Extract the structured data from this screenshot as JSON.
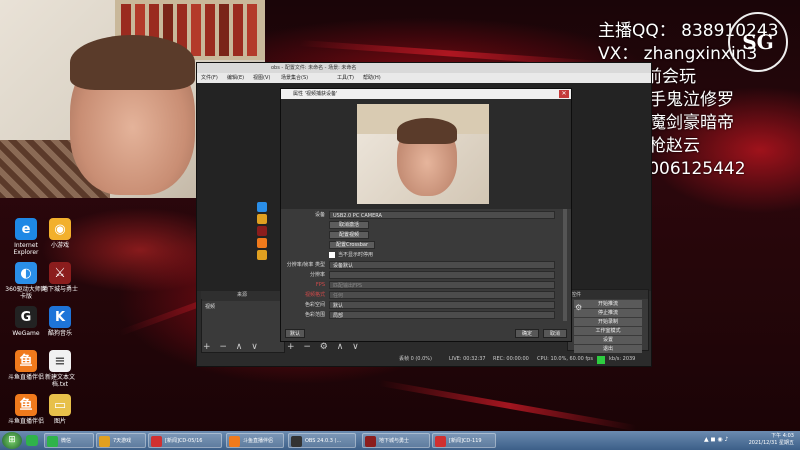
{
  "overlay": {
    "qq": "主播QQ：  838910243",
    "vx": "VX：  zhangxinxin3",
    "current_label": "目前会玩",
    "classes_line1": "红眼白手鬼泣修罗",
    "classes_line2": "剑宗剑魔剑豪暗帝",
    "classes_line3": "光枪赵云",
    "group": "群：  1006125442",
    "logo": "SG"
  },
  "desktop_icons": [
    {
      "label": "Internet Explorer",
      "icon": "ie-icon",
      "color": "#1e88e5",
      "glyph": "e"
    },
    {
      "label": "小游戏",
      "icon": "game-icon",
      "color": "#f2b02c",
      "glyph": "◉"
    },
    {
      "label": "360驱动大师网卡版",
      "icon": "driver-icon",
      "color": "#2a8ee8",
      "glyph": "◐"
    },
    {
      "label": "地下城与勇士",
      "icon": "dnf-icon",
      "color": "#8b1d1d",
      "glyph": "⚔"
    },
    {
      "label": "WeGame",
      "icon": "wegame-icon",
      "color": "#222222",
      "glyph": "G"
    },
    {
      "label": "酷狗音乐",
      "icon": "kugou-icon",
      "color": "#1e74d8",
      "glyph": "K"
    },
    {
      "label": "斗鱼直播伴侣",
      "icon": "douyu-icon",
      "color": "#f07a1c",
      "glyph": "鱼"
    },
    {
      "label": "新建文本文档.txt",
      "icon": "textfile-icon",
      "color": "#f1f1f1",
      "glyph": "≡"
    },
    {
      "label": "斗鱼直播伴侣",
      "icon": "douyu-icon",
      "color": "#f07a1c",
      "glyph": "鱼"
    },
    {
      "label": "图片",
      "icon": "folder-icon",
      "color": "#e7c04a",
      "glyph": "▭"
    }
  ],
  "obs": {
    "title": "obs - 配置文件: 未命名 - 场景: 未命名",
    "menu": [
      "文件(F)",
      "编辑(E)",
      "视图(V)",
      "场景集合(S)",
      "工具(T)",
      "帮助(H)"
    ],
    "scenes_title": "场景",
    "sources_title": "来源",
    "sources_item": "视频",
    "controls_title": "控件",
    "controls": [
      "开始推流",
      "停止推流",
      "开始录制",
      "工作室模式",
      "设置",
      "退出"
    ],
    "status": {
      "drop": "丢帧 0 (0.0%)",
      "live": "LIVE: 00:32:37",
      "rec": "REC: 00:00:00",
      "cpu": "CPU: 10.0%, 60.00 fps",
      "kbps": "kb/s: 2039"
    }
  },
  "dialog": {
    "title": "属性 '视频捕获设备'",
    "close": "✕",
    "rows": {
      "device_label": "设备",
      "device_value": "USB2.0 PC CAMERA",
      "btn_deactivate": "取消激活",
      "btn_configure_video": "配置视频",
      "btn_crossbar": "配置Crossbar",
      "checkbox_label": "当不显示时停用",
      "resolution_type_label": "分辨率/帧率 类型",
      "resolution_type_value": "设备默认",
      "resolution_label": "分辨率",
      "fps_label": "FPS",
      "fps_value": "匹配输出FPS",
      "video_format_label": "视频格式",
      "video_format_value": "任何",
      "color_space_label": "色彩空间",
      "color_space_value": "默认",
      "color_range_label": "色彩范围",
      "color_range_value": "局部"
    },
    "defaults_btn": "默认",
    "ok_btn": "确定",
    "cancel_btn": "取消"
  },
  "taskbar": {
    "items": [
      {
        "label": "微信",
        "color": "#2fb34a"
      },
      {
        "label": "7天游戏",
        "color": "#e0a020"
      },
      {
        "label": "[新闻]CD-05/16",
        "color": "#d03030"
      },
      {
        "label": "斗鱼直播伴侣",
        "color": "#f07a1c"
      },
      {
        "label": "OBS 24.0.3 (...",
        "color": "#333333"
      },
      {
        "label": "地下城与勇士",
        "color": "#8b1d1d"
      },
      {
        "label": "[新闻]CD-119",
        "color": "#d03030"
      }
    ],
    "time": "下午 4:03",
    "date": "2021/12/31 星期五"
  }
}
